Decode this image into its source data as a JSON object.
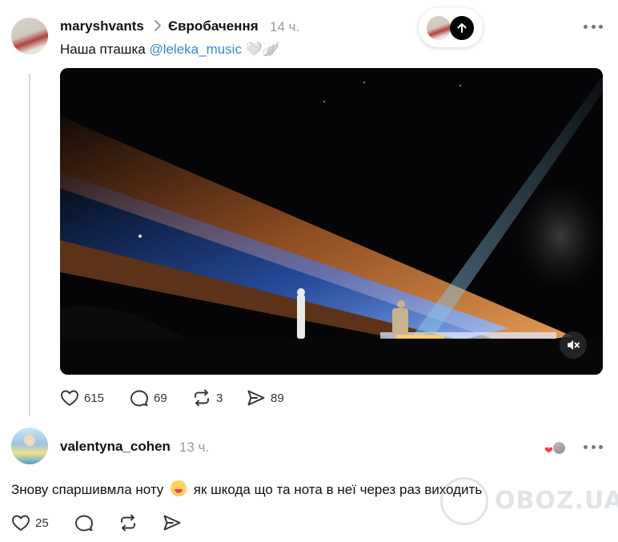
{
  "post": {
    "username": "maryshvants",
    "topic": "Євробачення",
    "time": "14 ч.",
    "text_prefix": "Наша пташка ",
    "mention": "@leleka_music",
    "emoji_suffix": " 🤍🪽",
    "media": {
      "type": "video",
      "muted": true
    },
    "stats": {
      "likes": "615",
      "replies": "69",
      "reposts": "3",
      "shares": "89"
    }
  },
  "reply": {
    "username": "valentyna_cohen",
    "time": "13 ч.",
    "text_before": "Знову спаршивмла ноту",
    "text_after": "як шкода що та нота в неї через раз виходить",
    "stats": {
      "likes": "25"
    }
  },
  "watermark": {
    "text": "OBOZ.UA"
  },
  "icons": [
    "chevron-right-icon",
    "arrow-up-icon",
    "more-icon",
    "mute-icon",
    "heart-icon",
    "comment-icon",
    "repost-icon",
    "share-icon"
  ],
  "colors": {
    "mention": "#3a85d6",
    "heart": "#ef3e55",
    "muted_text": "#999999"
  }
}
